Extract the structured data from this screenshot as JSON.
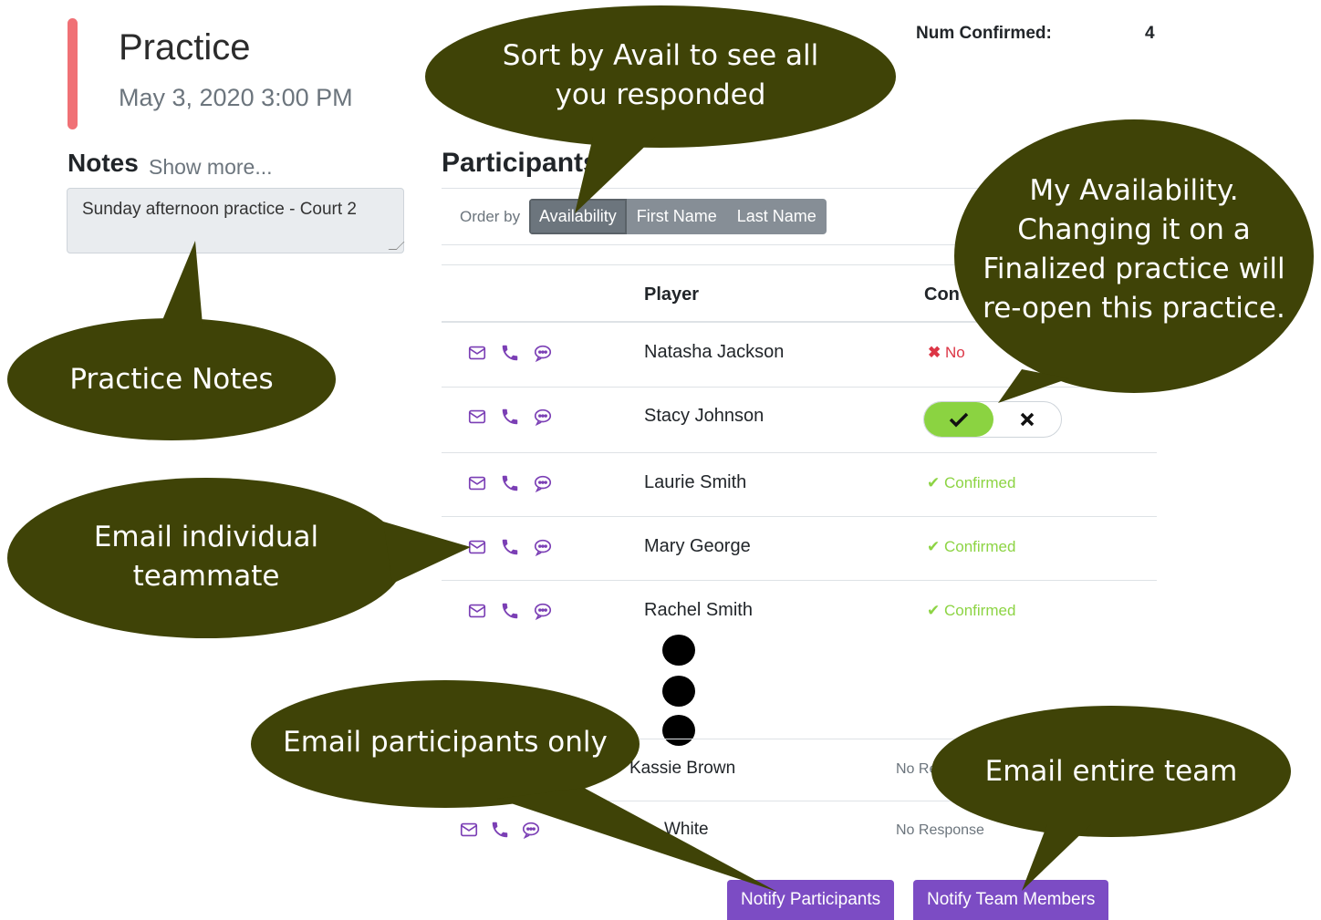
{
  "event": {
    "title": "Practice",
    "datetime": "May 3, 2020 3:00 PM"
  },
  "summary": {
    "confirmed_label": "Num Confirmed:",
    "confirmed_value": "4"
  },
  "notes": {
    "title": "Notes",
    "show_more": "Show more...",
    "text": "Sunday afternoon practice - Court 2"
  },
  "participants": {
    "title": "Participants",
    "order_label": "Order by",
    "order_options": [
      "Availability",
      "First Name",
      "Last Name"
    ],
    "order_selected": "Availability",
    "col_player": "Player",
    "col_confirmed": "Con"
  },
  "players": [
    {
      "name": "Natasha Jackson",
      "status": "No"
    },
    {
      "name": "Stacy Johnson",
      "status": ""
    },
    {
      "name": "Laurie Smith",
      "status": "Confirmed"
    },
    {
      "name": "Mary George",
      "status": "Confirmed"
    },
    {
      "name": "Rachel Smith",
      "status": "Confirmed"
    },
    {
      "name": "Kassie Brown",
      "status": "No Re"
    },
    {
      "name": "White",
      "status": "No Response"
    }
  ],
  "actions": {
    "notify_participants": "Notify Participants",
    "notify_team": "Notify Team Members"
  },
  "callouts": {
    "sort_line1": "Sort by Avail to see all",
    "sort_line2": "you responded",
    "notes": "Practice Notes",
    "email_line1": "Email individual",
    "email_line2": "teammate",
    "avail_line1": "My Availability.",
    "avail_line2": "Changing it on a",
    "avail_line3": "Finalized practice will",
    "avail_line4": "re-open this practice.",
    "participants_only": "Email participants only",
    "entire_team": "Email entire team"
  },
  "colors": {
    "accent": "#f07176",
    "callout": "#3f4307",
    "confirmed": "#8dd444",
    "declined": "#dc3545",
    "purple": "#7c4cc4"
  },
  "icons": [
    "envelope-icon",
    "phone-icon",
    "chat-icon",
    "check-icon",
    "x-icon"
  ]
}
